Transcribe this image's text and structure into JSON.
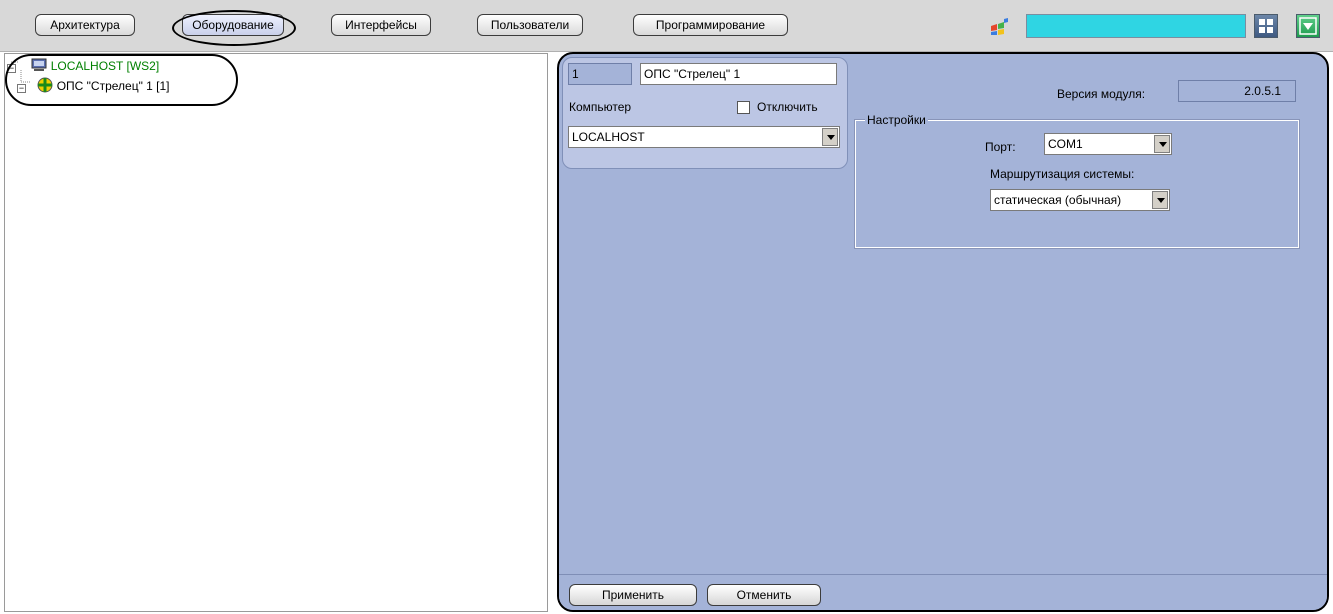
{
  "toolbar": {
    "tabs": [
      {
        "label": "Архитектура"
      },
      {
        "label": "Оборудование"
      },
      {
        "label": "Интерфейсы"
      },
      {
        "label": "Пользователи"
      },
      {
        "label": "Программирование"
      }
    ],
    "active_tab": "Оборудование",
    "search_value": "",
    "icons": [
      "windows-flag-icon",
      "layout-grid-icon",
      "dropdown-menu-icon"
    ]
  },
  "tree": {
    "root": {
      "label": "LOCALHOST [WS2]",
      "icon": "computer-icon"
    },
    "child": {
      "label": "ОПС \"Стрелец\" 1 [1]",
      "icon": "strelets-device-icon"
    }
  },
  "object": {
    "id": "1",
    "name": "ОПС \"Стрелец\" 1",
    "computer_label": "Компьютер",
    "disable_label": "Отключить",
    "disable_checked": false,
    "computer_value": "LOCALHOST"
  },
  "module": {
    "version_label": "Версия модуля:",
    "version_value": "2.0.5.1"
  },
  "settings": {
    "group_title": "Настройки",
    "port_label": "Порт:",
    "port_value": "COM1",
    "routing_label": "Маршрутизация системы:",
    "routing_value": "статическая (обычная)"
  },
  "actions": {
    "apply_label": "Применить",
    "cancel_label": "Отменить"
  },
  "colors": {
    "panel_bg": "#a4b3d8",
    "search_bg": "#2fd5e3",
    "tree_root_text": "#008000"
  }
}
